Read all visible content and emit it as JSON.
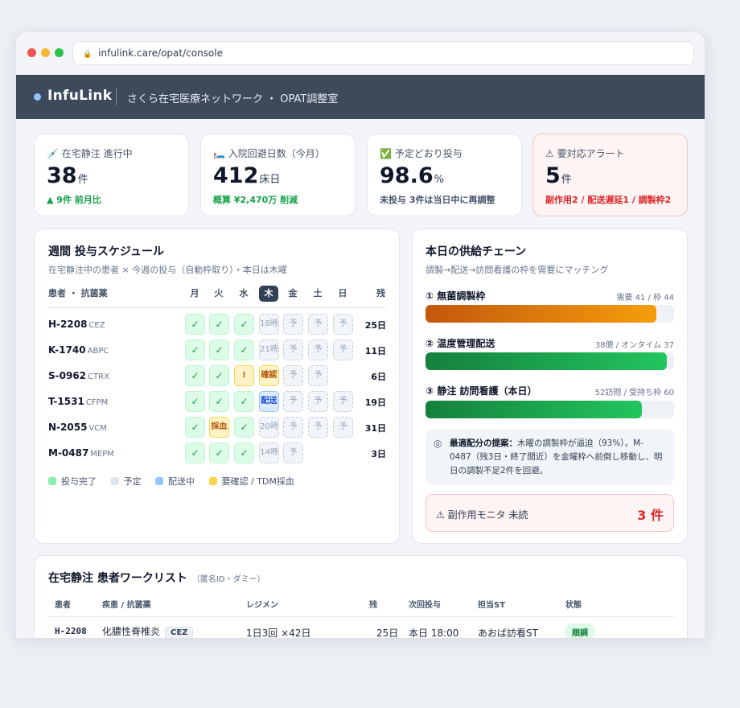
{
  "browser": {
    "url": "infulink.care/opat/console"
  },
  "app": {
    "brand": "InfuLink",
    "org": "さくら在宅医療ネットワーク ・ OPAT調整室"
  },
  "kpis": [
    {
      "label": "💉 在宅静注 進行中",
      "value": "38",
      "unit": "件",
      "sub": "▲ 9件 前月比"
    },
    {
      "label": "🛏️ 入院回避日数（今月）",
      "value": "412",
      "unit": "床日",
      "sub": "概算 ¥2,470万 削減"
    },
    {
      "label": "✅ 予定どおり投与",
      "value": "98.6",
      "unit": "%",
      "sub": "未投与 3件は当日中に再調整"
    },
    {
      "label": "⚠ 要対応アラート",
      "value": "5",
      "unit": "件",
      "sub": "副作用2 / 配送遅延1 / 調製枠2"
    }
  ],
  "schedule": {
    "title": "週間 投与スケジュール",
    "subtitle": "在宅静注中の患者 × 今週の投与（自動枠取り）・本日は木曜",
    "col_patient": "患者 ・ 抗菌薬",
    "col_remaining": "残",
    "days": [
      "月",
      "火",
      "水",
      "木",
      "金",
      "土",
      "日"
    ],
    "today_index": 3,
    "patients": [
      {
        "id": "H-2208",
        "drug": "CEZ",
        "cells": [
          "✓",
          "✓",
          "✓",
          "18時",
          "予",
          "予",
          "予"
        ],
        "types": [
          "done",
          "done",
          "done",
          "plan",
          "plan",
          "plan",
          "plan"
        ],
        "remaining": "25日"
      },
      {
        "id": "K-1740",
        "drug": "ABPC",
        "cells": [
          "✓",
          "✓",
          "✓",
          "21時",
          "予",
          "予",
          "予"
        ],
        "types": [
          "done",
          "done",
          "done",
          "plan",
          "plan",
          "plan",
          "plan"
        ],
        "remaining": "11日"
      },
      {
        "id": "S-0962",
        "drug": "CTRX",
        "cells": [
          "✓",
          "✓",
          "!",
          "確認",
          "予",
          "予",
          ""
        ],
        "types": [
          "done",
          "done",
          "warn",
          "warn",
          "plan",
          "plan",
          "none"
        ],
        "remaining": "6日"
      },
      {
        "id": "T-1531",
        "drug": "CFPM",
        "cells": [
          "✓",
          "✓",
          "✓",
          "配送",
          "予",
          "予",
          "予"
        ],
        "types": [
          "done",
          "done",
          "done",
          "deliv",
          "plan",
          "plan",
          "plan"
        ],
        "remaining": "19日"
      },
      {
        "id": "N-2055",
        "drug": "VCM",
        "cells": [
          "✓",
          "採血",
          "✓",
          "20時",
          "予",
          "予",
          "予"
        ],
        "types": [
          "done",
          "warn",
          "done",
          "plan",
          "plan",
          "plan",
          "plan"
        ],
        "remaining": "31日"
      },
      {
        "id": "M-0487",
        "drug": "MEPM",
        "cells": [
          "✓",
          "✓",
          "✓",
          "14時",
          "予",
          "",
          ""
        ],
        "types": [
          "done",
          "done",
          "done",
          "plan",
          "plan",
          "none",
          "none"
        ],
        "remaining": "3日"
      }
    ],
    "legend": [
      "投与完了",
      "予定",
      "配送中",
      "要確認 / TDM採血"
    ]
  },
  "supply": {
    "title": "本日の供給チェーン",
    "subtitle": "調製→配送→訪問看護の枠を需要にマッチング",
    "rows": [
      {
        "label": "① 無菌調製枠",
        "note": "需要 41 / 枠 44",
        "fill": 0.93,
        "color": "orange"
      },
      {
        "label": "② 温度管理配送",
        "note": "38便 / オンタイム 37",
        "fill": 0.97,
        "color": "green"
      },
      {
        "label": "③ 静注 訪問看護（本日）",
        "note": "52訪問 / 受持ち枠 60",
        "fill": 0.87,
        "color": "green"
      }
    ],
    "suggest_icon": "◎",
    "suggest_lead": "最適配分の提案：",
    "suggest_text": "木曜の調製枠が逼迫（93%）。M-0487（残3日・終了間近）を金曜枠へ前倒し移動し、明日の調製不足2件を回避。",
    "monitor_label": "⚠ 副作用モニタ 未読",
    "monitor_value": "3 件"
  },
  "worklist": {
    "title": "在宅静注 患者ワークリスト",
    "note": "（匿名ID・ダミー）",
    "headers": [
      "患者",
      "疾患 / 抗菌薬",
      "レジメン",
      "残",
      "次回投与",
      "担当ST",
      "状態"
    ],
    "rows": [
      {
        "id": "H-2208",
        "disease": "化膿性脊椎炎",
        "drug": "CEZ",
        "regimen": "1日3回 ×42日",
        "remaining": "25日",
        "next": "本日 18:00",
        "station": "あおば訪看ST",
        "status": "順調"
      }
    ]
  },
  "colors": {
    "done": "#dcfce7",
    "plan": "#e2e8f0",
    "deliv": "#93c5fd",
    "warn": "#fcd34d"
  }
}
